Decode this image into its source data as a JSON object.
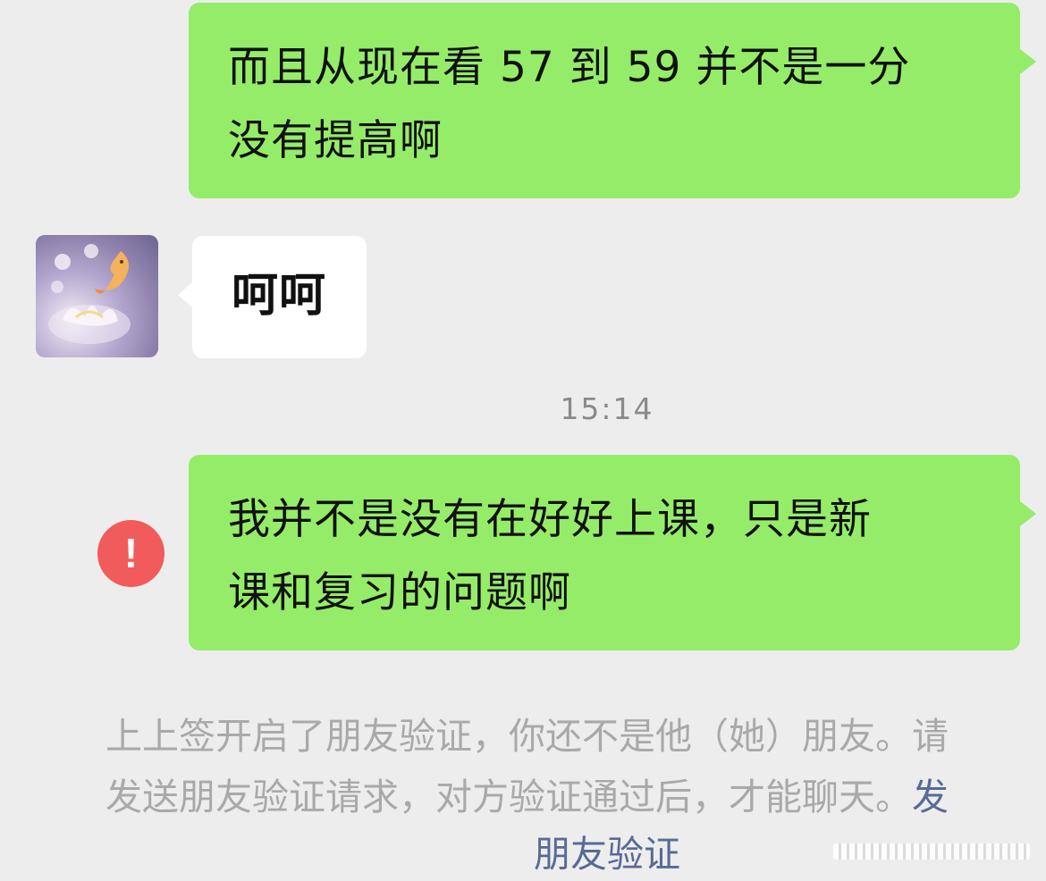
{
  "chat": {
    "messages": [
      {
        "direction": "outgoing",
        "text": "而且从现在看 57 到 59 并不是一分\n没有提高啊"
      },
      {
        "direction": "incoming",
        "text": "呵呵"
      },
      {
        "direction": "outgoing",
        "text": "我并不是没有在好好上课，只是新\n课和复习的问题啊",
        "status": "send-failed"
      }
    ],
    "timestamp": "15:14",
    "error_icon_glyph": "!",
    "system_notice": {
      "line1": "上上签开启了朋友验证，你还不是他（她）朋友。请",
      "line1_link": "",
      "line2": "发送朋友验证请求，对方验证通过后，才能聊天。",
      "line2_link": "发",
      "action_link": "朋友验证"
    }
  },
  "colors": {
    "background": "#ededed",
    "outgoing_bubble": "#95ec69",
    "incoming_bubble": "#ffffff",
    "error": "#f25b5b",
    "link": "#576b95",
    "muted": "#a9a9a9"
  },
  "icons": {
    "avatar": "goldfish-lotus-avatar",
    "error": "exclamation-circle-icon"
  }
}
